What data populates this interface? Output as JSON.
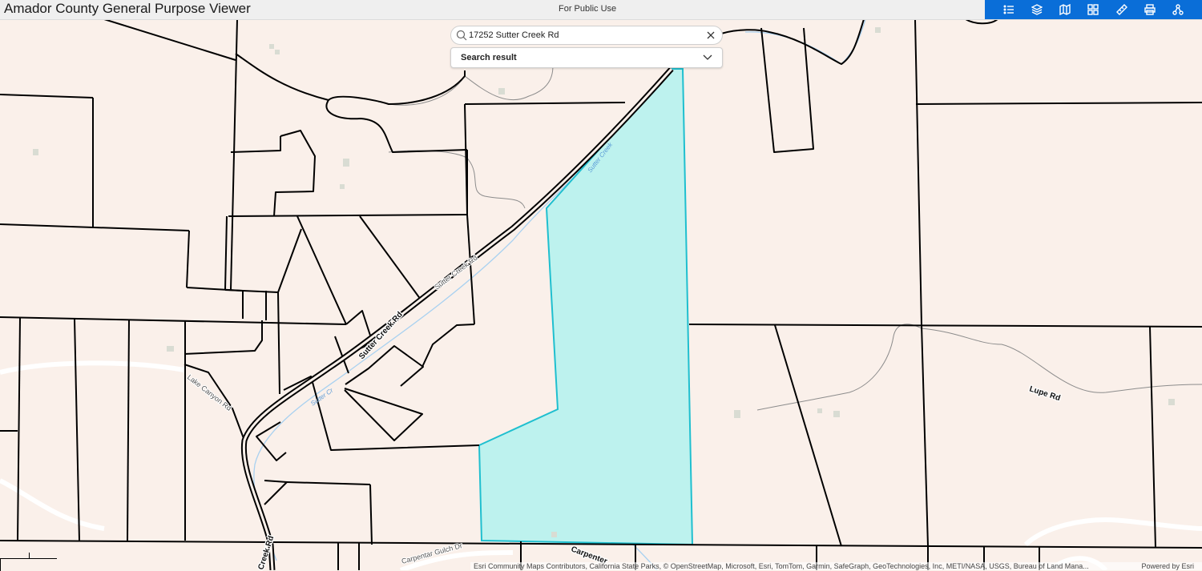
{
  "header": {
    "title": "Amador County General Purpose Viewer",
    "subtitle": "For Public Use",
    "toolbar_icons": [
      "legend-icon",
      "layers-icon",
      "basemap-icon",
      "widgets-grid-icon",
      "measure-icon",
      "print-icon",
      "share-icon"
    ]
  },
  "search": {
    "value": "17252 Sutter Creek Rd",
    "result_label": "Search result"
  },
  "map": {
    "selected_parcel_fill": "#bdf2ee",
    "selected_parcel_stroke": "#1fbfcf",
    "background": "#faf0ea",
    "labels": {
      "sutter_creek_rd_main": "Sutter Creek Rd",
      "sutter_creek_rd_upper": "Sutter Creek Rd",
      "sutter_creek_rd_lower": "Creek Rd",
      "sutter_creek_water": "Sutter Creek",
      "sutter_creek_water_lower": "Sutter Cr",
      "lake_canyon_rd": "Lake Canyon Rd",
      "lupe_rd": "Lupe Rd",
      "carpenter_gulch": "Carpentar Gulch Dr",
      "carpenter_rd": "Carpenter"
    }
  },
  "attribution": {
    "text": "Esri Community Maps Contributors, California State Parks, © OpenStreetMap, Microsoft, Esri, TomTom, Garmin, SafeGraph, GeoTechnologies, Inc, METI/NASA, USGS, Bureau of Land Mana...",
    "powered": "Powered by Esri"
  }
}
